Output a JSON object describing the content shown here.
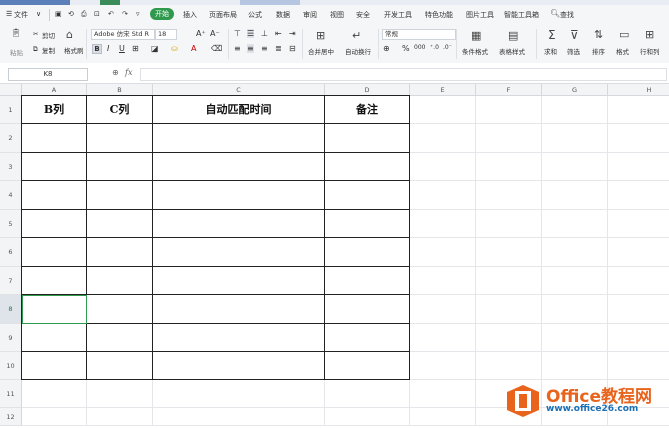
{
  "menu": {
    "file": "文件",
    "tabs": [
      "开始",
      "插入",
      "页面布局",
      "公式",
      "数据",
      "审阅",
      "视图",
      "安全",
      "开发工具",
      "特色功能",
      "图片工具",
      "智能工具箱"
    ],
    "active_tab": "开始",
    "search": "查找"
  },
  "ribbon": {
    "paste": "粘贴",
    "cut": "剪切",
    "copy": "复制",
    "format_painter": "格式刷",
    "font_name": "Adobe 仿宋 Std R",
    "font_size": "18",
    "merge_center": "合并居中",
    "wrap_text": "自动换行",
    "number_format": "常规",
    "conditional_format": "条件格式",
    "table_style": "表格样式",
    "sum": "求和",
    "filter": "筛选",
    "sort": "排序",
    "format": "格式",
    "row_col": "行和列"
  },
  "formula_bar": {
    "name_box": "K8",
    "fx": "fx",
    "value": ""
  },
  "sheet": {
    "columns": [
      "A",
      "B",
      "C",
      "D",
      "E",
      "F",
      "G",
      "H"
    ],
    "rows": [
      "1",
      "2",
      "3",
      "4",
      "5",
      "6",
      "7",
      "8",
      "9",
      "10",
      "11",
      "12"
    ],
    "selected_row": "8",
    "selected_cell": "A8",
    "headers": [
      "B列",
      "C列",
      "自动匹配时间",
      "备注"
    ]
  },
  "watermark": {
    "brand": "Office教程网",
    "url": "www.office26.com"
  },
  "colors": {
    "accent": "#2f9a4e",
    "watermark_orange": "#e8641c",
    "watermark_blue": "#1b6fb5"
  }
}
